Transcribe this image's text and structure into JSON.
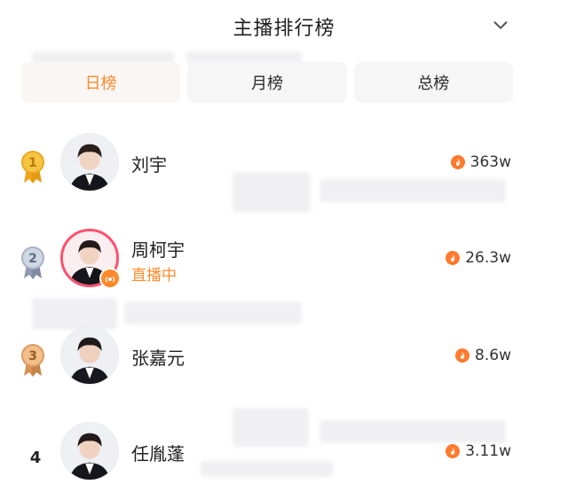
{
  "header": {
    "title": "主播排行榜"
  },
  "tabs": [
    {
      "label": "日榜",
      "active": true
    },
    {
      "label": "月榜",
      "active": false
    },
    {
      "label": "总榜",
      "active": false
    }
  ],
  "ranking": [
    {
      "rank": "1",
      "badge": "gold-medal-icon",
      "name": "刘宇",
      "status": "",
      "score": "363w"
    },
    {
      "rank": "2",
      "badge": "silver-medal-icon",
      "name": "周柯宇",
      "status": "直播中",
      "score": "26.3w"
    },
    {
      "rank": "3",
      "badge": "bronze-medal-icon",
      "name": "张嘉元",
      "status": "",
      "score": "8.6w"
    },
    {
      "rank": "4",
      "badge": "",
      "name": "任胤蓬",
      "status": "",
      "score": "3.11w"
    }
  ],
  "colors": {
    "accent": "#ff8a2b",
    "live_ring": "#ff4f6e",
    "gold": "#f2b428",
    "silver": "#a9b4c6",
    "bronze": "#e3a26a"
  }
}
